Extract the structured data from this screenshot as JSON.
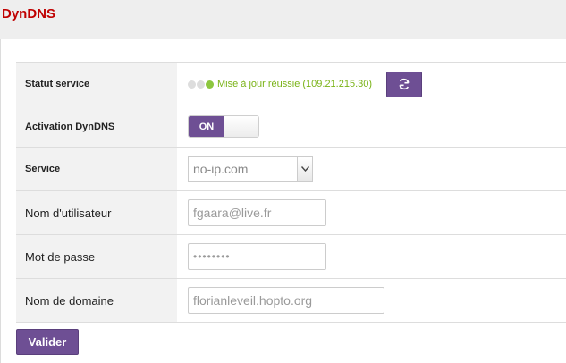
{
  "page": {
    "title": "DynDNS"
  },
  "status": {
    "label": "Statut service",
    "text": "Mise à jour réussie (109.21.215.30)",
    "refresh_icon": "refresh-icon",
    "indicator_colors": [
      "#dddddd",
      "#dddddd",
      "#8cc63f"
    ]
  },
  "activation": {
    "label": "Activation DynDNS",
    "on_label": "ON",
    "state": "on"
  },
  "service": {
    "label": "Service",
    "selected": "no-ip.com"
  },
  "username": {
    "label": "Nom d'utilisateur",
    "value": "fgaara@live.fr"
  },
  "password": {
    "label": "Mot de passe",
    "masked": "••••••••"
  },
  "domain": {
    "label": "Nom de domaine",
    "value": "florianleveil.hopto.org"
  },
  "submit": {
    "label": "Valider"
  },
  "colors": {
    "accent": "#6e4f94",
    "title": "#c00000",
    "success": "#7ab317"
  }
}
